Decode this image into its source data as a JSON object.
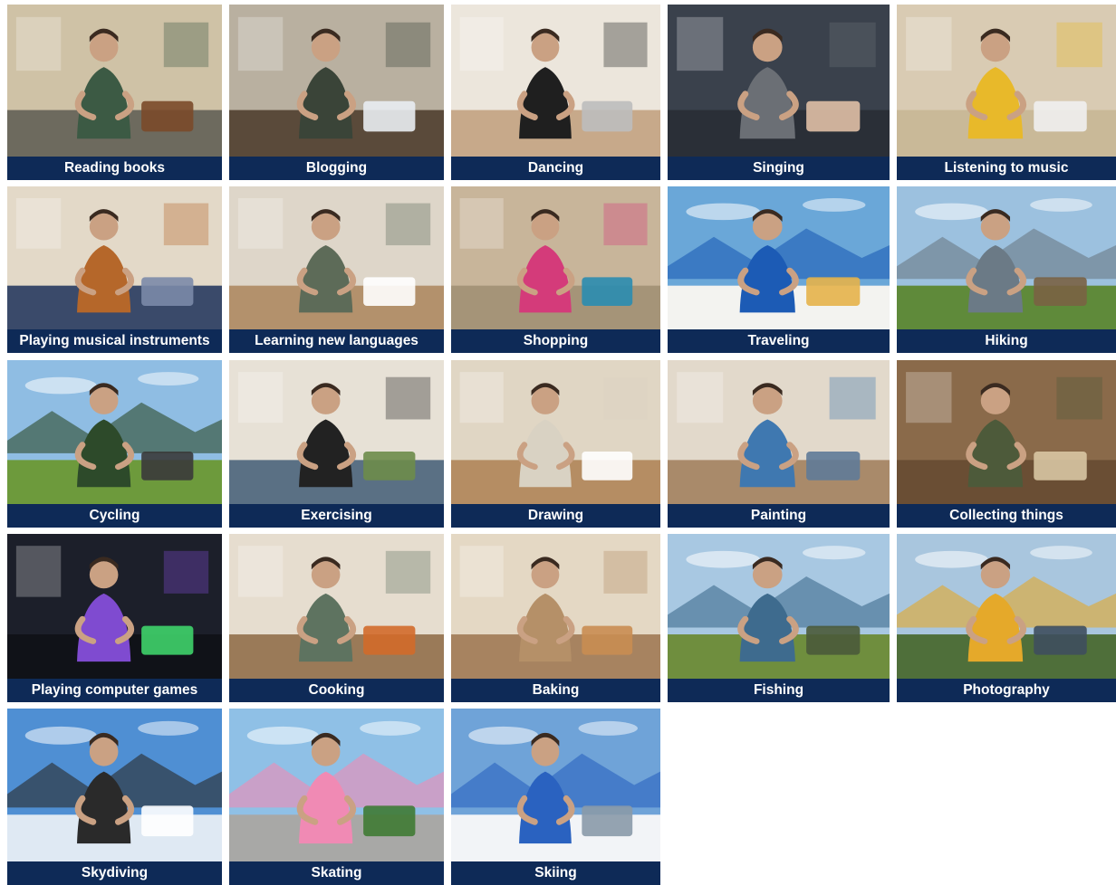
{
  "hobbies": [
    {
      "label": "Reading books",
      "icon": "reading-books-photo",
      "scene": {
        "bg": "#cfc2a6",
        "ground": "#6d6a5e",
        "accent": "#3c5a44",
        "item": "#7a4a2a",
        "sky": false
      }
    },
    {
      "label": "Blogging",
      "icon": "blogging-photo",
      "scene": {
        "bg": "#b9b0a0",
        "ground": "#5a4a3a",
        "accent": "#3a4438",
        "item": "#e9edf2",
        "sky": false
      }
    },
    {
      "label": "Dancing",
      "icon": "dancing-photo",
      "scene": {
        "bg": "#ece6dc",
        "ground": "#c7a98a",
        "accent": "#1f1f1f",
        "item": "#bdbdbd",
        "sky": false
      }
    },
    {
      "label": "Singing",
      "icon": "singing-photo",
      "scene": {
        "bg": "#3a414c",
        "ground": "#2a2f37",
        "accent": "#6b6f75",
        "item": "#e0c0a6",
        "sky": false
      }
    },
    {
      "label": "Listening to music",
      "icon": "listening-to-music-photo",
      "scene": {
        "bg": "#d9cbb3",
        "ground": "#c9b998",
        "accent": "#e8b92a",
        "item": "#f0f0f0",
        "sky": false
      }
    },
    {
      "label": "Playing musical instruments",
      "icon": "playing-musical-instruments-photo",
      "scene": {
        "bg": "#e3d9c8",
        "ground": "#3a4a6a",
        "accent": "#b5672a",
        "item": "#7b8aa8",
        "sky": false
      }
    },
    {
      "label": "Learning new languages",
      "icon": "learning-new-languages-photo",
      "scene": {
        "bg": "#ded6c9",
        "ground": "#b3916c",
        "accent": "#5d6b58",
        "item": "#ffffff",
        "sky": false
      }
    },
    {
      "label": "Shopping",
      "icon": "shopping-photo",
      "scene": {
        "bg": "#c8b59a",
        "ground": "#a59478",
        "accent": "#d43b7a",
        "item": "#2a8cb0",
        "sky": false
      }
    },
    {
      "label": "Traveling",
      "icon": "traveling-photo",
      "scene": {
        "bg": "#6aa7d8",
        "ground": "#f3f3f0",
        "accent": "#1c5bb5",
        "item": "#e6b34a",
        "sky": true
      }
    },
    {
      "label": "Hiking",
      "icon": "hiking-photo",
      "scene": {
        "bg": "#9cc1df",
        "ground": "#5f8a3a",
        "accent": "#6b7a86",
        "item": "#7a6244",
        "sky": true
      }
    },
    {
      "label": "Cycling",
      "icon": "cycling-photo",
      "scene": {
        "bg": "#8fbde3",
        "ground": "#6d9a3c",
        "accent": "#2d4a2a",
        "item": "#3a3a3a",
        "sky": true
      }
    },
    {
      "label": "Exercising",
      "icon": "exercising-photo",
      "scene": {
        "bg": "#e7e1d6",
        "ground": "#5a7084",
        "accent": "#222222",
        "item": "#6d8c4a",
        "sky": false
      }
    },
    {
      "label": "Drawing",
      "icon": "drawing-photo",
      "scene": {
        "bg": "#e0d6c4",
        "ground": "#b58d63",
        "accent": "#d9d2c3",
        "item": "#ffffff",
        "sky": false
      }
    },
    {
      "label": "Painting",
      "icon": "painting-photo",
      "scene": {
        "bg": "#e2d9cb",
        "ground": "#a98a6a",
        "accent": "#3f78b0",
        "item": "#5f7a98",
        "sky": false
      }
    },
    {
      "label": "Collecting things",
      "icon": "collecting-things-photo",
      "scene": {
        "bg": "#8a6a4a",
        "ground": "#6a4e34",
        "accent": "#4d5a3a",
        "item": "#d8c7a3",
        "sky": false
      }
    },
    {
      "label": "Playing computer games",
      "icon": "playing-computer-games-photo",
      "scene": {
        "bg": "#1c1f2a",
        "ground": "#101218",
        "accent": "#7f4bd0",
        "item": "#3fd36a",
        "sky": false
      }
    },
    {
      "label": "Cooking",
      "icon": "cooking-photo",
      "scene": {
        "bg": "#e6ddcf",
        "ground": "#9a7a58",
        "accent": "#5e7360",
        "item": "#d26a2a",
        "sky": false
      }
    },
    {
      "label": "Baking",
      "icon": "baking-photo",
      "scene": {
        "bg": "#e4d8c4",
        "ground": "#a78360",
        "accent": "#b59068",
        "item": "#c98d52",
        "sky": false
      }
    },
    {
      "label": "Fishing",
      "icon": "fishing-photo",
      "scene": {
        "bg": "#a8c8e2",
        "ground": "#6f8e3e",
        "accent": "#3e6b8e",
        "item": "#4a5a3a",
        "sky": true
      }
    },
    {
      "label": "Photography",
      "icon": "photography-photo",
      "scene": {
        "bg": "#a9c6de",
        "ground": "#4f6f3a",
        "accent": "#e5a92a",
        "item": "#3e4e5e",
        "sky": true
      }
    },
    {
      "label": "Skydiving",
      "icon": "skydiving-photo",
      "scene": {
        "bg": "#4f8fd3",
        "ground": "#dfe9f3",
        "accent": "#2a2a2a",
        "item": "#ffffff",
        "sky": true
      }
    },
    {
      "label": "Skating",
      "icon": "skating-photo",
      "scene": {
        "bg": "#8fc0e6",
        "ground": "#a8a8a6",
        "accent": "#f08ab4",
        "item": "#3f7a34",
        "sky": true
      }
    },
    {
      "label": "Skiing",
      "icon": "skiing-photo",
      "scene": {
        "bg": "#6fa3d8",
        "ground": "#f2f4f7",
        "accent": "#2a62c0",
        "item": "#8a9aa8",
        "sky": true
      }
    }
  ]
}
